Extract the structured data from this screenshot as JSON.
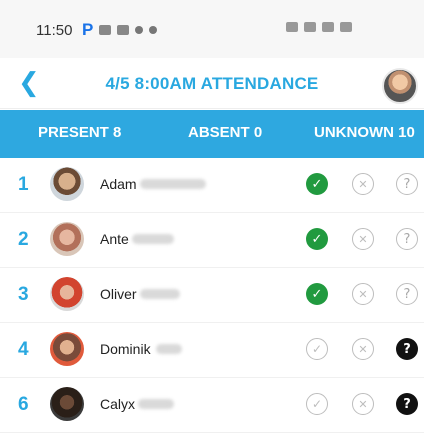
{
  "status_bar": {
    "time": "11:50",
    "app_letter": "P"
  },
  "header": {
    "back_icon": "chevron-left-icon",
    "title": "4/5 8:00AM ATTENDANCE"
  },
  "tabs": [
    {
      "label": "PRESENT 8"
    },
    {
      "label": "ABSENT 0"
    },
    {
      "label": "UNKNOWN 10"
    }
  ],
  "rows": [
    {
      "number": "1",
      "name": "Adam",
      "status": "present"
    },
    {
      "number": "2",
      "name": "Ante",
      "status": "present"
    },
    {
      "number": "3",
      "name": "Oliver",
      "status": "present"
    },
    {
      "number": "4",
      "name": "Dominik",
      "status": "unknown"
    },
    {
      "number": "6",
      "name": "Calyx",
      "status": "unknown"
    }
  ],
  "colors": {
    "accent": "#29a8e0",
    "present_green": "#219a3f",
    "unknown_black": "#111111"
  }
}
